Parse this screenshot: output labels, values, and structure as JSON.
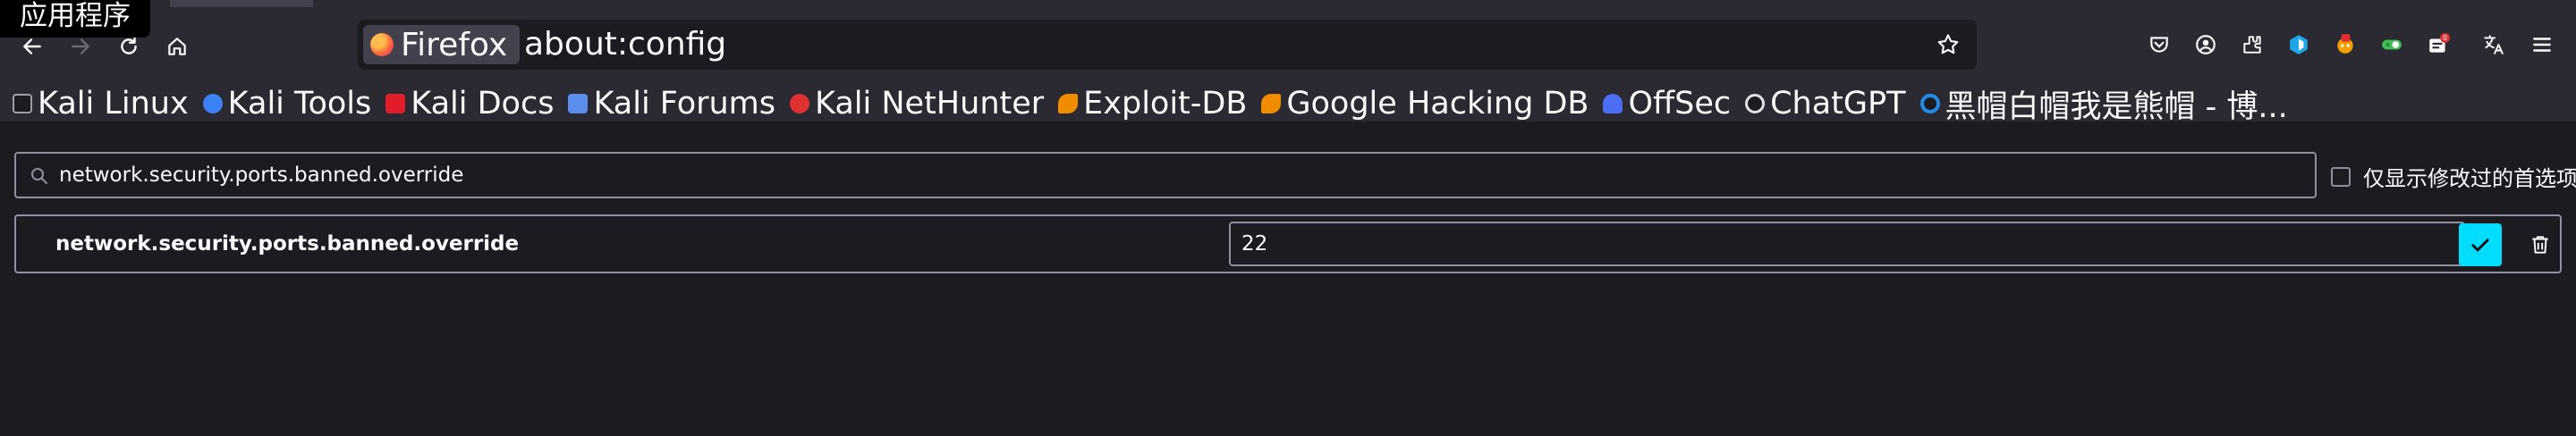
{
  "tooltip": "应用程序",
  "urlbar": {
    "identity_label": "Firefox",
    "url": "about:config"
  },
  "toolbar_icons": [
    "pocket-icon",
    "account-icon",
    "extensions-icon",
    "bitwarden-icon",
    "extension-fox-icon",
    "extension-toggle-icon",
    "extension-badge-icon",
    "translate-icon",
    "menu-icon"
  ],
  "badge_count": "0",
  "bookmarks": [
    {
      "label": "Kali Linux",
      "color": "#367bf0"
    },
    {
      "label": "Kali Tools",
      "color": "#3b82f6"
    },
    {
      "label": "Kali Docs",
      "color": "#e11d2a"
    },
    {
      "label": "Kali Forums",
      "color": "#5b8def"
    },
    {
      "label": "Kali NetHunter",
      "color": "#e03131"
    },
    {
      "label": "Exploit-DB",
      "color": "#f08c00"
    },
    {
      "label": "Google Hacking DB",
      "color": "#f08c00"
    },
    {
      "label": "OffSec",
      "color": "#4c6ef5"
    },
    {
      "label": "ChatGPT",
      "color": "#dee2e6"
    },
    {
      "label": "黑帽白帽我是熊帽 - 博...",
      "color": "#228be6"
    }
  ],
  "config": {
    "search_value": "network.security.ports.banned.override",
    "show_modified_label": "仅显示修改过的首选项",
    "show_modified_checked": false,
    "pref_name": "network.security.ports.banned.override",
    "pref_value": "22"
  },
  "colors": {
    "accent": "#00ddff",
    "toolbar_bg": "#2b2a33",
    "page_bg": "#1c1b22"
  }
}
